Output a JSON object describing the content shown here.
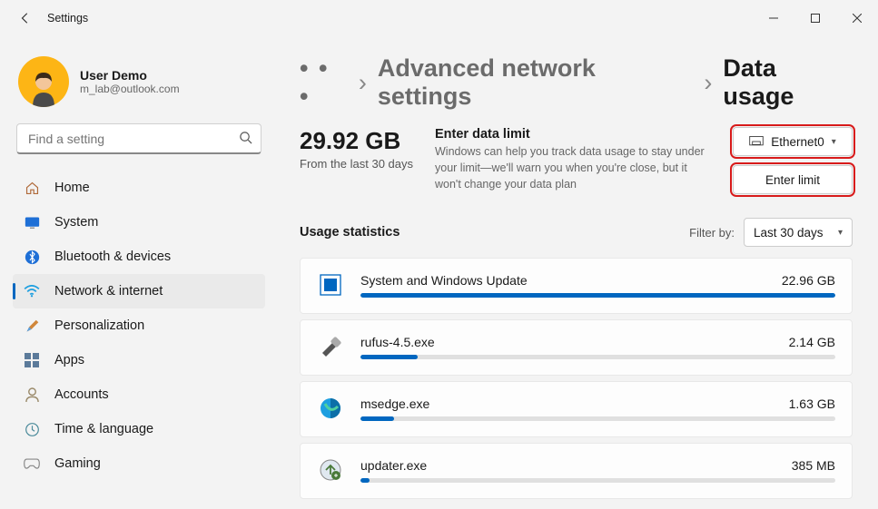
{
  "window": {
    "title": "Settings"
  },
  "profile": {
    "name": "User Demo",
    "email": "m_lab@outlook.com"
  },
  "search": {
    "placeholder": "Find a setting"
  },
  "nav": {
    "items": [
      {
        "label": "Home"
      },
      {
        "label": "System"
      },
      {
        "label": "Bluetooth & devices"
      },
      {
        "label": "Network & internet"
      },
      {
        "label": "Personalization"
      },
      {
        "label": "Apps"
      },
      {
        "label": "Accounts"
      },
      {
        "label": "Time & language"
      },
      {
        "label": "Gaming"
      }
    ]
  },
  "breadcrumb": {
    "ellipsis": "• • •",
    "mid": "Advanced network settings",
    "current": "Data usage"
  },
  "usage": {
    "amount": "29.92 GB",
    "period": "From the last 30 days",
    "limit_title": "Enter data limit",
    "limit_desc": "Windows can help you track data usage to stay under your limit—we'll warn you when you're close, but it won't change your data plan",
    "adapter": "Ethernet0",
    "enter_limit": "Enter limit"
  },
  "stats": {
    "title": "Usage statistics",
    "filter_label": "Filter by:",
    "filter_value": "Last 30 days",
    "items": [
      {
        "name": "System and Windows Update",
        "value": "22.96 GB",
        "pct": 100
      },
      {
        "name": "rufus-4.5.exe",
        "value": "2.14 GB",
        "pct": 12
      },
      {
        "name": "msedge.exe",
        "value": "1.63 GB",
        "pct": 7
      },
      {
        "name": "updater.exe",
        "value": "385 MB",
        "pct": 2
      }
    ]
  }
}
